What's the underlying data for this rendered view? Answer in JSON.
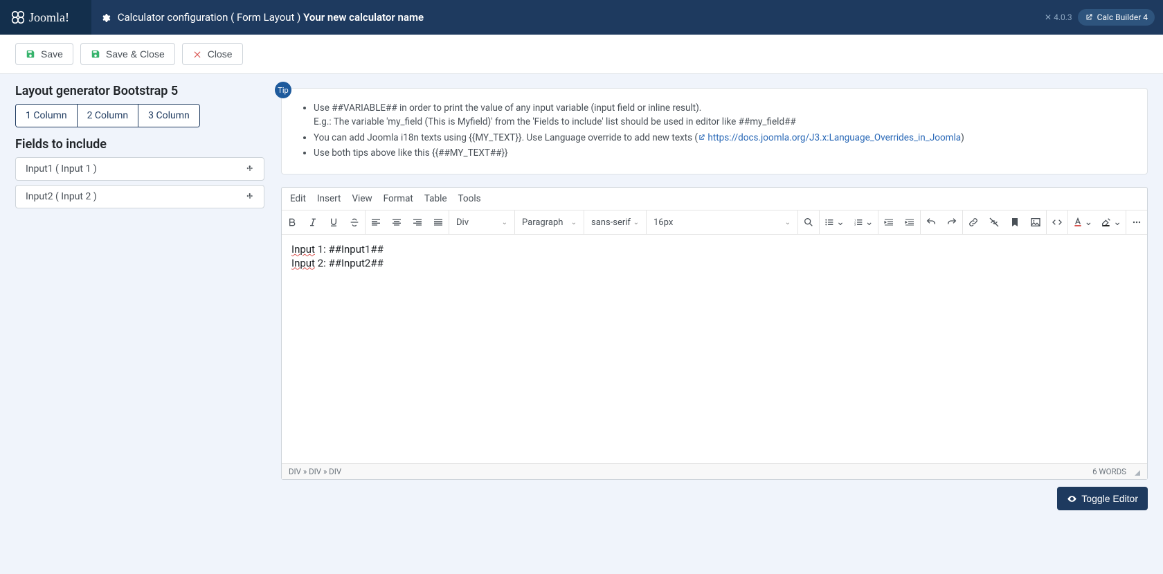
{
  "topbar": {
    "brand": "Joomla!",
    "title_prefix": "Calculator configuration ( Form Layout )",
    "title_name": "Your new calculator name",
    "version": "4.0.3",
    "badge": "Calc Builder 4"
  },
  "actions": {
    "save": "Save",
    "save_close": "Save & Close",
    "close": "Close"
  },
  "sidebar": {
    "generator_title": "Layout generator Bootstrap 5",
    "cols": [
      "1 Column",
      "2 Column",
      "3 Column"
    ],
    "fields_title": "Fields to include",
    "fields": [
      {
        "label": "Input1 ( Input 1 )"
      },
      {
        "label": "Input2 ( Input 2 )"
      }
    ]
  },
  "tip": {
    "badge": "Tip",
    "items": {
      "a1": "Use ##VARIABLE## in order to print the value of any input variable (input field or inline result).",
      "a2": "E.g.: The variable 'my_field (This is Myfield)' from the 'Fields to include' list should be used in editor like ##my_field##",
      "b1": "You can add Joomla i18n texts using {{MY_TEXT}}. Use Language override to add new texts (",
      "b_link": "https://docs.joomla.org/J3.x:Language_Overrides_in_Joomla",
      "b2": ")",
      "c": "Use both tips above like this {{##MY_TEXT##}}"
    }
  },
  "editor": {
    "menus": [
      "Edit",
      "Insert",
      "View",
      "Format",
      "Table",
      "Tools"
    ],
    "block_sel": "Div",
    "para_sel": "Paragraph",
    "font_sel": "sans-serif",
    "size_sel": "16px",
    "content": {
      "l1_pre": "Input",
      "l1_post": " 1: ##Input1##",
      "l2_pre": "Input",
      "l2_post": " 2: ##Input2##"
    },
    "path": "DIV » DIV » DIV",
    "wordcount": "6 WORDS",
    "toggle": "Toggle Editor"
  }
}
